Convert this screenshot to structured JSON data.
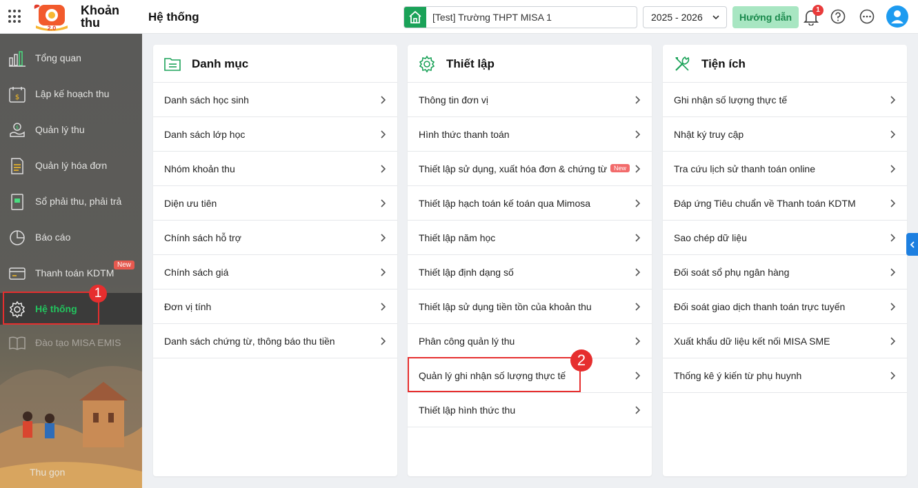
{
  "app": {
    "name_line1": "Khoản",
    "name_line2": "thu",
    "logo_badge": "2.0",
    "page_title": "Hệ thống"
  },
  "header": {
    "school": "[Test] Trường THPT MISA 1",
    "year": "2025 - 2026",
    "guide_label": "Hướng dẫn",
    "notification_count": "1",
    "accent_color": "#1aa258"
  },
  "sidebar": {
    "items": [
      {
        "label": "Tổng quan",
        "icon": "bar-chart-icon"
      },
      {
        "label": "Lập kế hoạch thu",
        "icon": "calendar-money-icon"
      },
      {
        "label": "Quản lý thu",
        "icon": "coin-hand-icon"
      },
      {
        "label": "Quản lý hóa đơn",
        "icon": "invoice-icon"
      },
      {
        "label": "Sổ phải thu, phải trả",
        "icon": "ledger-book-icon"
      },
      {
        "label": "Báo cáo",
        "icon": "pie-chart-icon"
      },
      {
        "label": "Thanh toán KDTM",
        "icon": "card-payment-icon"
      },
      {
        "label": "Hệ thống",
        "icon": "gear-icon"
      },
      {
        "label": "Đào tạo MISA EMIS",
        "icon": "open-book-icon"
      }
    ],
    "new_badge": "New",
    "collapse_label": "Thu gọn",
    "active_color": "#22c55e"
  },
  "markers": {
    "one": "1",
    "two": "2"
  },
  "cards": {
    "catalog": {
      "title": "Danh mục",
      "items": [
        "Danh sách học sinh",
        "Danh sách lớp học",
        "Nhóm khoản thu",
        "Diện ưu tiên",
        "Chính sách hỗ trợ",
        "Chính sách giá",
        "Đơn vị tính",
        "Danh sách chứng từ, thông báo thu tiền"
      ]
    },
    "settings": {
      "title": "Thiết lập",
      "new_badge": "New",
      "items": [
        "Thông tin đơn vị",
        "Hình thức thanh toán",
        "Thiết lập sử dụng, xuất hóa đơn & chứng từ",
        "Thiết lập hạch toán kế toán qua Mimosa",
        "Thiết lập năm học",
        "Thiết lập định dạng số",
        "Thiết lập sử dụng tiền tồn của khoản thu",
        "Phân công quản lý thu",
        "Quản lý ghi nhận số lượng thực tế",
        "Thiết lập hình thức thu"
      ]
    },
    "utilities": {
      "title": "Tiện ích",
      "items": [
        "Ghi nhận số lượng thực tế",
        "Nhật ký truy cập",
        "Tra cứu lịch sử thanh toán online",
        "Đáp ứng Tiêu chuẩn về Thanh toán KDTM",
        "Sao chép dữ liệu",
        "Đối soát sổ phụ ngân hàng",
        "Đối soát giao dịch thanh toán trực tuyến",
        "Xuất khẩu dữ liệu kết nối MISA SME",
        "Thống kê ý kiến từ phụ huynh"
      ]
    }
  }
}
